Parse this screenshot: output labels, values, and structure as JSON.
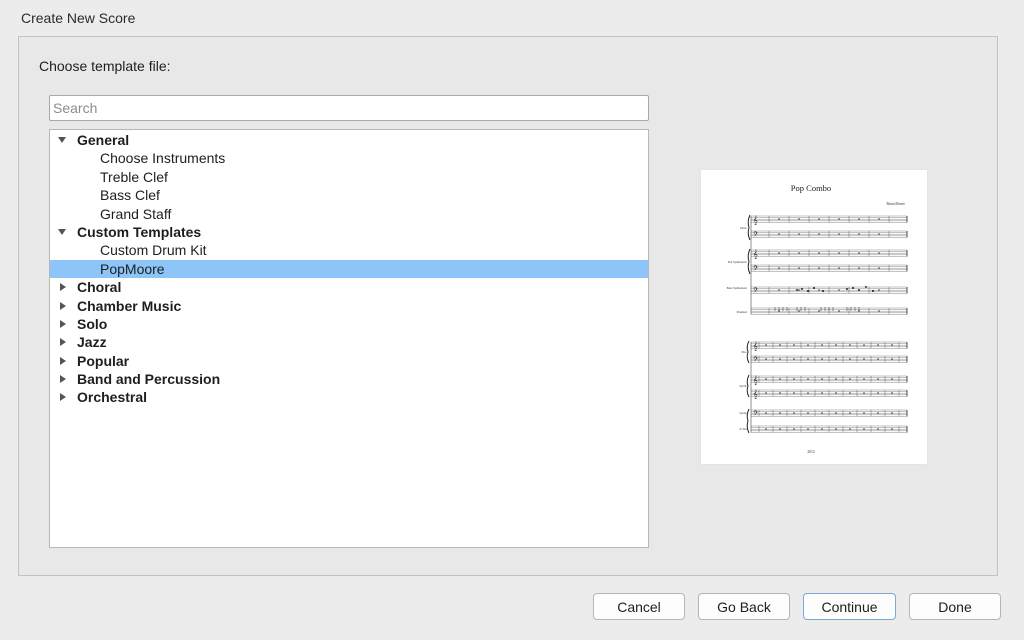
{
  "window": {
    "title": "Create New Score"
  },
  "panel": {
    "heading": "Choose template file:"
  },
  "search": {
    "placeholder": "Search",
    "value": ""
  },
  "tree": [
    {
      "label": "General",
      "type": "category",
      "expanded": true
    },
    {
      "label": "Choose Instruments",
      "type": "item"
    },
    {
      "label": "Treble Clef",
      "type": "item"
    },
    {
      "label": "Bass Clef",
      "type": "item"
    },
    {
      "label": "Grand Staff",
      "type": "item"
    },
    {
      "label": "Custom Templates",
      "type": "category",
      "expanded": true
    },
    {
      "label": "Custom Drum Kit",
      "type": "item"
    },
    {
      "label": "PopMoore",
      "type": "item",
      "selected": true
    },
    {
      "label": "Choral",
      "type": "category",
      "expanded": false
    },
    {
      "label": "Chamber Music",
      "type": "category",
      "expanded": false
    },
    {
      "label": "Solo",
      "type": "category",
      "expanded": false
    },
    {
      "label": "Jazz",
      "type": "category",
      "expanded": false
    },
    {
      "label": "Popular",
      "type": "category",
      "expanded": false
    },
    {
      "label": "Band and Percussion",
      "type": "category",
      "expanded": false
    },
    {
      "label": "Orchestral",
      "type": "category",
      "expanded": false
    }
  ],
  "preview": {
    "title": "Pop Combo",
    "composer": "Brian Moore",
    "footer": "2012",
    "staff_labels": [
      "Piano",
      "Pad Synthesizer",
      "Bass Synthesizer",
      "Drumset",
      "Pno.",
      "Synth.",
      "Synth.",
      "D. Kit"
    ]
  },
  "buttons": {
    "cancel": "Cancel",
    "back": "Go Back",
    "continue": "Continue",
    "done": "Done"
  },
  "colors": {
    "selection": "#8ec5f8",
    "window_bg": "#ececec",
    "primary_border": "#7fa7d6"
  }
}
